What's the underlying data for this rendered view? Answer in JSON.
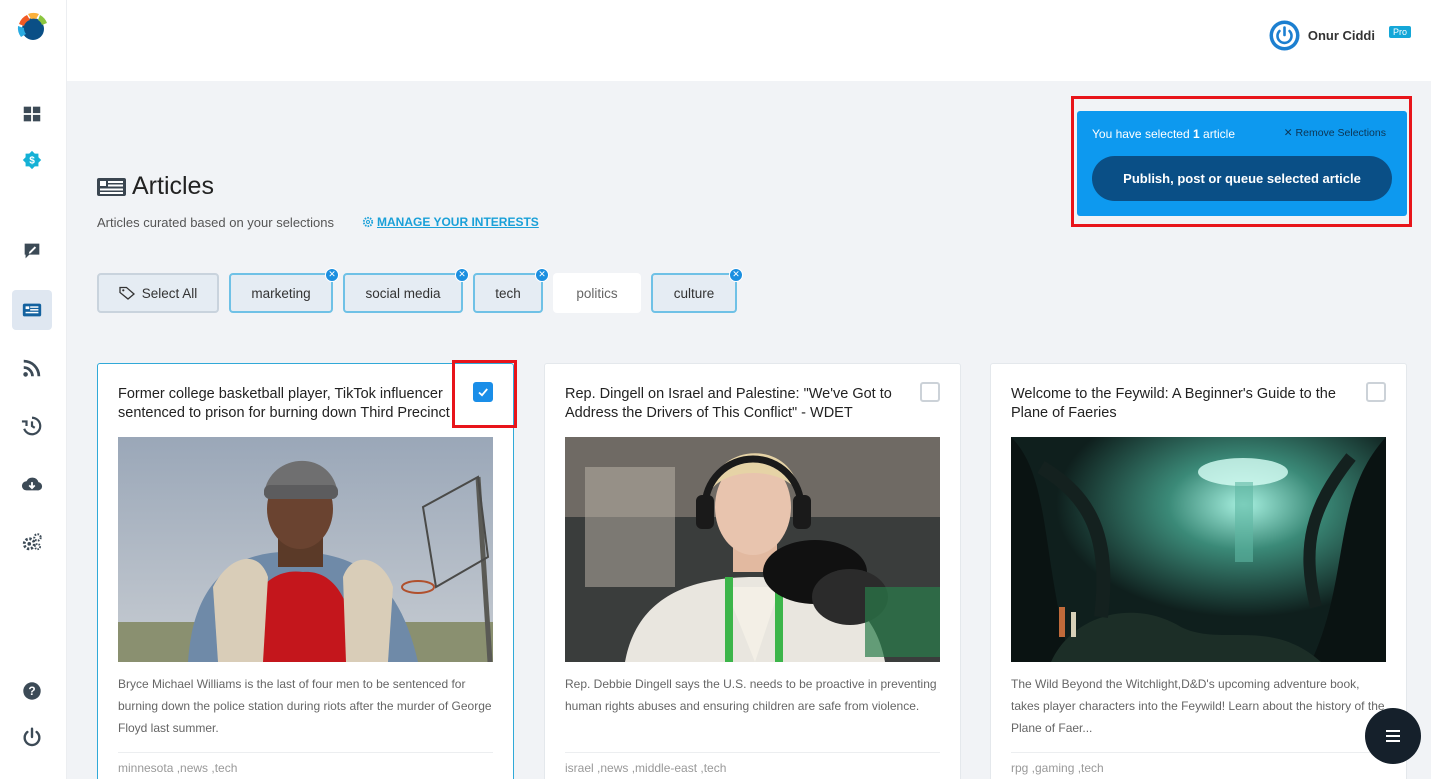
{
  "user": {
    "name": "Onur Ciddi",
    "badge": "Pro"
  },
  "sidebar": {
    "items": [
      {
        "icon": "dashboard-grid-icon"
      },
      {
        "icon": "dollar-badge-icon"
      },
      {
        "icon": "compose-icon"
      },
      {
        "icon": "articles-icon",
        "active": true
      },
      {
        "icon": "rss-icon"
      },
      {
        "icon": "history-icon"
      },
      {
        "icon": "cloud-download-icon"
      },
      {
        "icon": "settings-gears-icon"
      },
      {
        "icon": "help-icon"
      },
      {
        "icon": "power-icon"
      }
    ]
  },
  "header": {
    "title": "Articles",
    "subtitle": "Articles curated based on your selections",
    "manage_link": "MANAGE YOUR INTERESTS"
  },
  "selection": {
    "prefix": "You have selected",
    "count": "1",
    "suffix": "article",
    "remove_label": "Remove Selections",
    "publish_label": "Publish, post or queue selected article"
  },
  "filters": {
    "select_all": "Select All",
    "tags": [
      {
        "label": "marketing",
        "selected": true
      },
      {
        "label": "social media",
        "selected": true
      },
      {
        "label": "tech",
        "selected": true
      },
      {
        "label": "politics",
        "selected": false
      },
      {
        "label": "culture",
        "selected": true
      }
    ]
  },
  "articles": [
    {
      "title": "Former college basketball player, TikTok influencer sentenced to prison for burning down Third Precinct",
      "description": "Bryce Michael Williams is the last of four men to be sentenced for burning down the police station during riots after the murder of George Floyd last summer.",
      "tags": "minnesota ,news ,tech",
      "checked": true
    },
    {
      "title": "Rep. Dingell on Israel and Palestine: \"We've Got to Address the Drivers of This Conflict\" - WDET",
      "description": "Rep. Debbie Dingell says the U.S. needs to be proactive in preventing human rights abuses and ensuring children are safe from violence.",
      "tags": "israel ,news ,middle-east ,tech",
      "checked": false
    },
    {
      "title": "Welcome to the Feywild: A Beginner's Guide to the Plane of Faeries",
      "description": "The Wild Beyond the Witchlight,D&D's upcoming adventure book, takes player characters into the Feywild! Learn about the history of the Plane of Faer...",
      "tags": "rpg ,gaming ,tech",
      "checked": false
    }
  ],
  "colors": {
    "accent": "#0d99ef",
    "publish_button": "#0a4f86",
    "link": "#1aa0d8",
    "highlight_frame": "#e8141a"
  }
}
